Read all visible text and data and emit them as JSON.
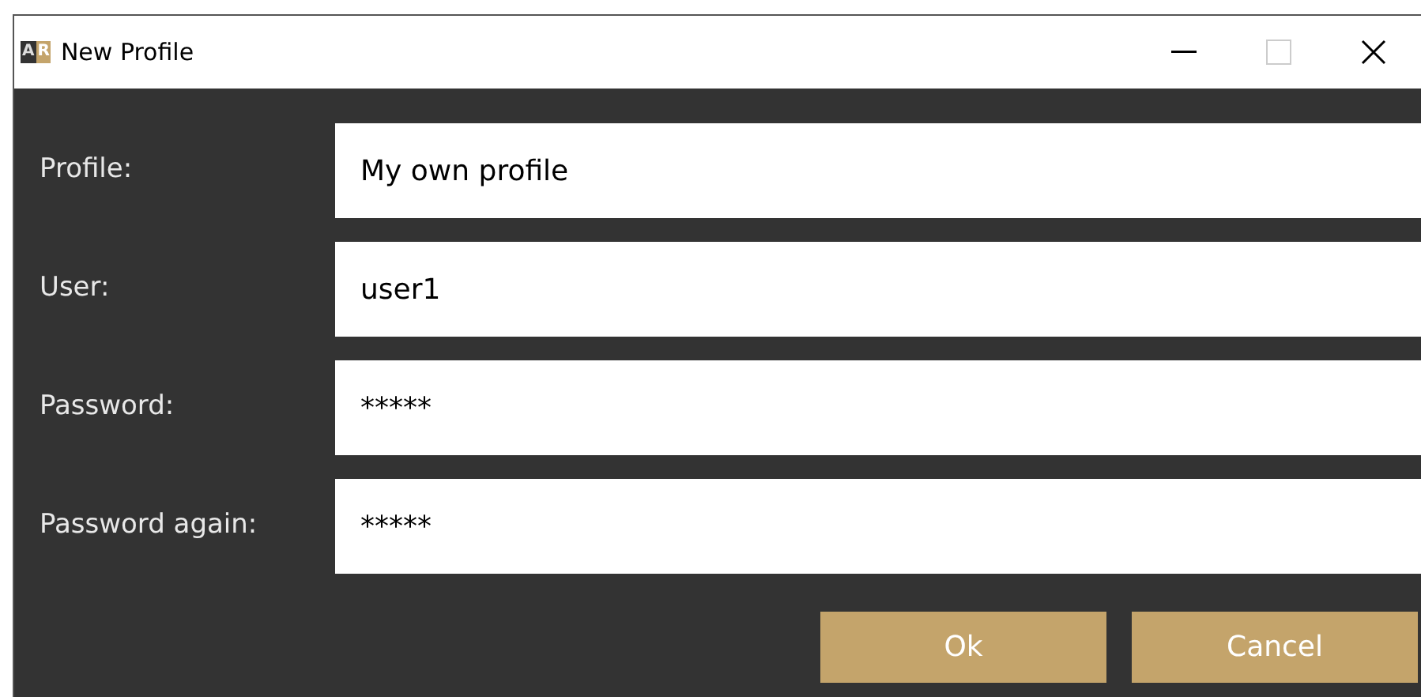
{
  "window": {
    "logo": [
      "A",
      "R"
    ],
    "title": "New Profile",
    "maximize_disabled": true
  },
  "fields": [
    {
      "label": "Profile:",
      "value": "My own profile"
    },
    {
      "label": "User:",
      "value": "user1"
    },
    {
      "label": "Password:",
      "value": "*****"
    },
    {
      "label": "Password again:",
      "value": "*****"
    }
  ],
  "buttons": [
    "Ok",
    "Cancel"
  ]
}
